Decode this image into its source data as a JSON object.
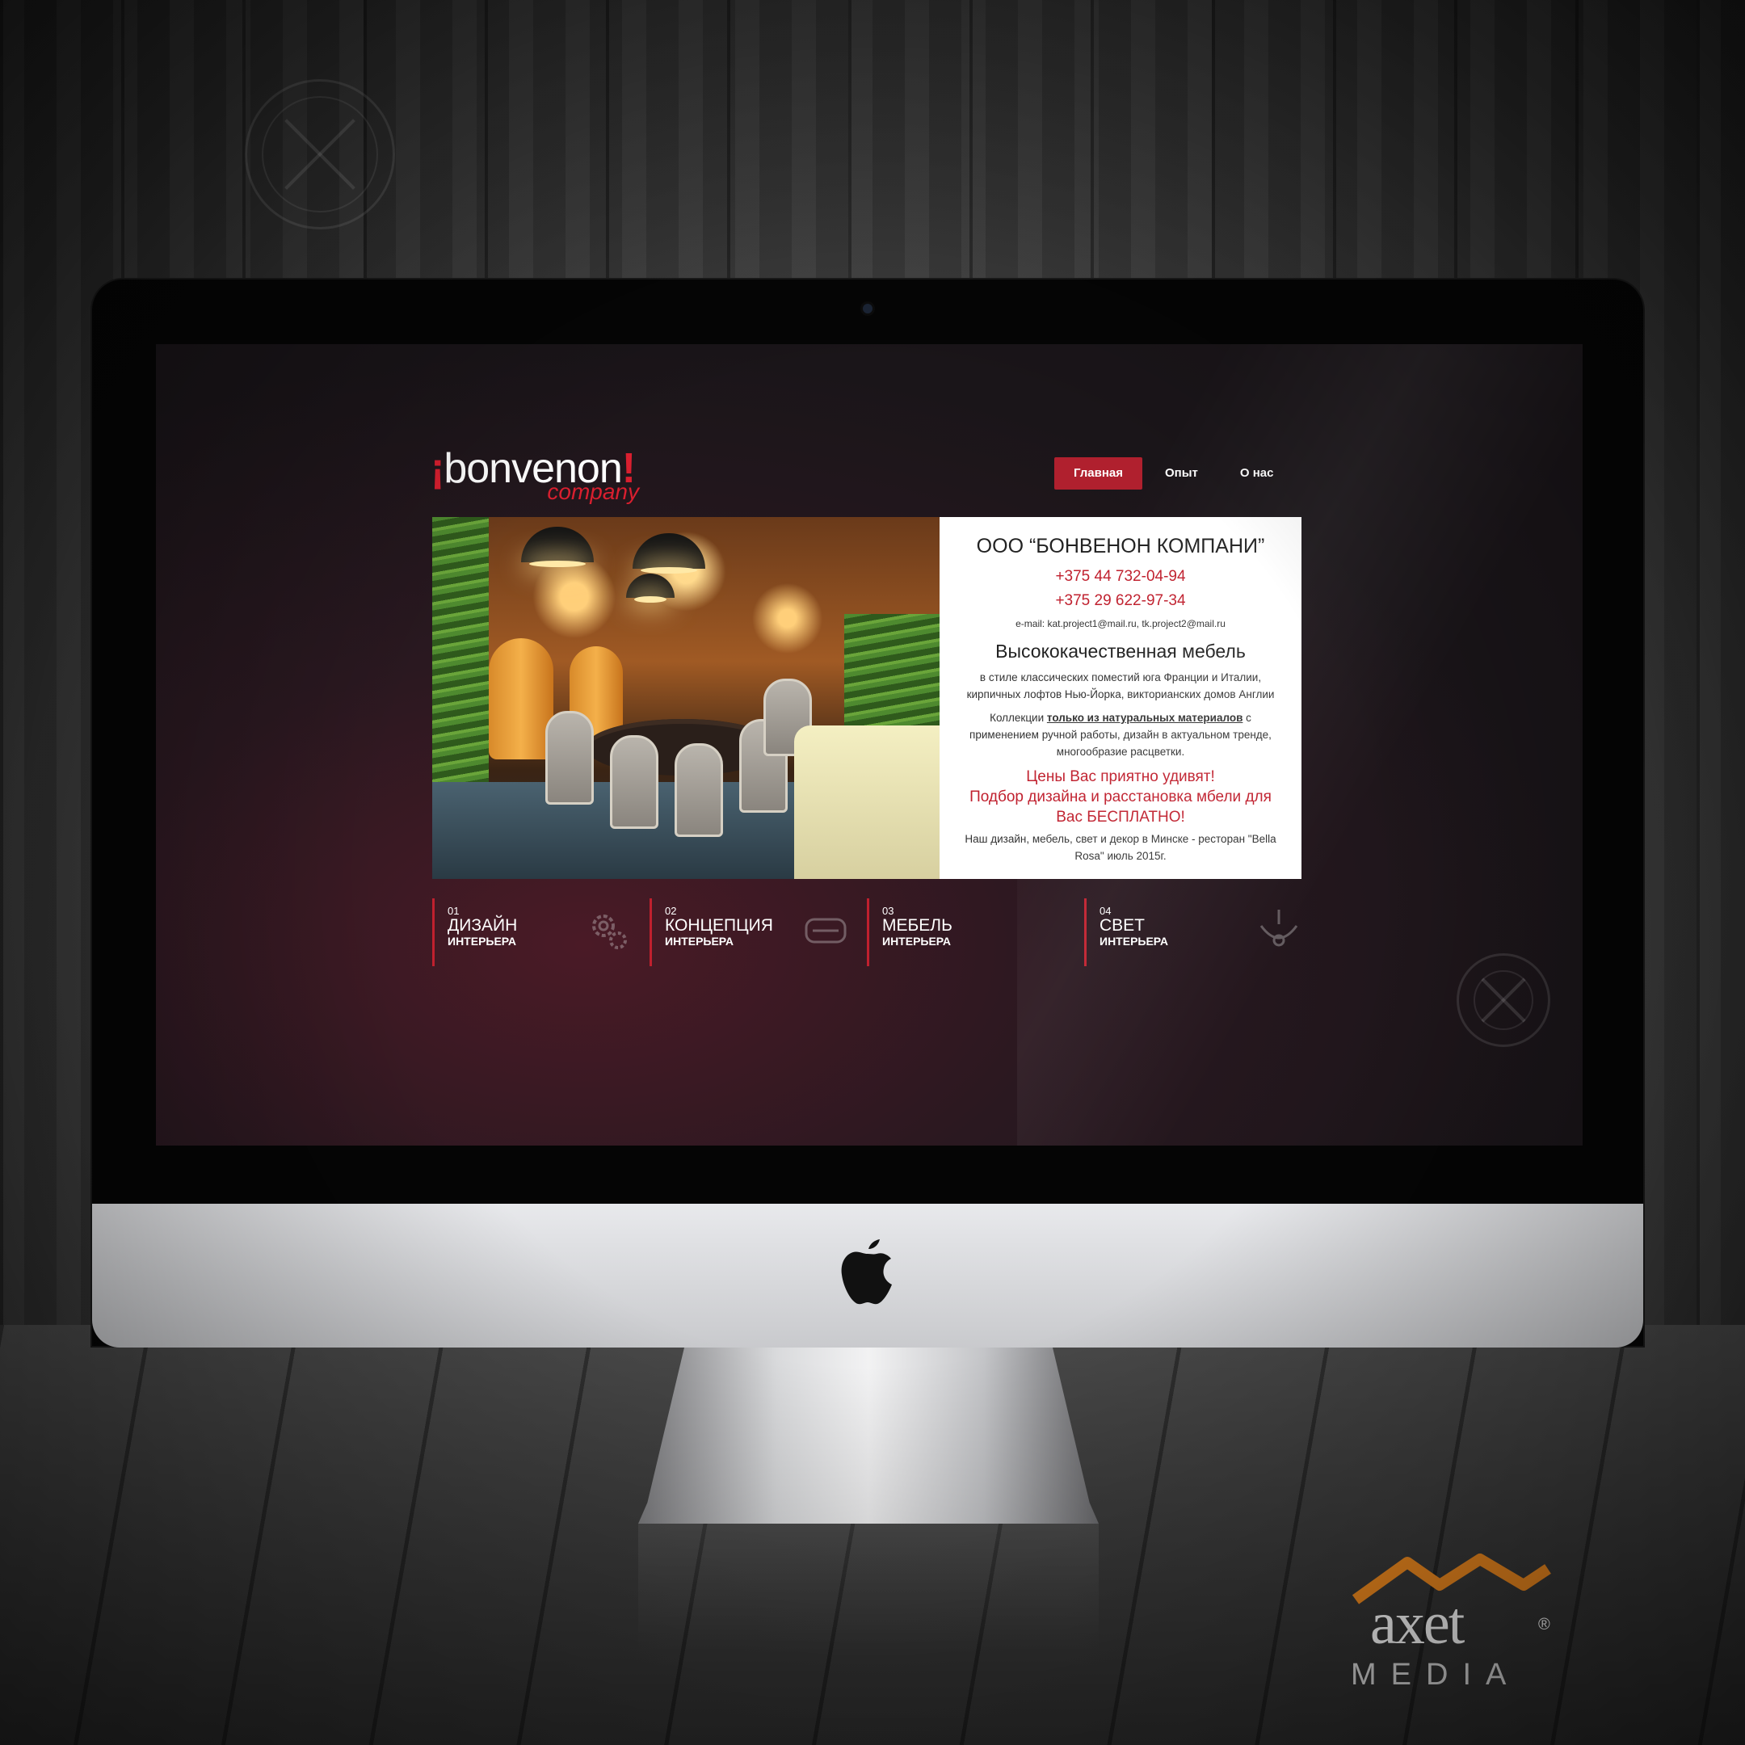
{
  "site": {
    "logo": {
      "main": "bonvenon",
      "sub": "company"
    },
    "nav": [
      {
        "label": "Главная",
        "active": true
      },
      {
        "label": "Опыт",
        "active": false
      },
      {
        "label": "О нас",
        "active": false
      }
    ],
    "hero": {
      "company": "ООО “БОНВЕНОН КОМПАНИ”",
      "phones": [
        "+375 44 732-04-94",
        "+375 29 622-97-34"
      ],
      "email": "e-mail: kat.project1@mail.ru, tk.project2@mail.ru",
      "headline": "Высококачественная мебель",
      "styles": "в стиле классических поместий юга Франции и Италии, кирпичных лофтов Нью-Йорка, викторианских домов Англии",
      "collections_prefix": "Коллекции ",
      "collections_emph": "только из натуральных материалов",
      "collections_suffix": " с применением ручной работы, дизайн в актуальном тренде, многообразие расцветки.",
      "offer_1": "Цены Вас приятно удивят!",
      "offer_2": "Подбор дизайна и расстановка мбели для Вас БЕСПЛАТНО!",
      "project": "Наш дизайн, мебель, свет и декор в Минске - ресторан \"Bella Rosa\" июль 2015г."
    },
    "services": [
      {
        "num": "01",
        "title": "ДИЗАЙН",
        "sub": "ИНТЕРЬЕРА",
        "icon": "brush-icon"
      },
      {
        "num": "02",
        "title": "КОНЦЕПЦИЯ",
        "sub": "ИНТЕРЬЕРА",
        "icon": "gears-icon"
      },
      {
        "num": "03",
        "title": "МЕБЕЛЬ",
        "sub": "ИНТЕРЬЕРА",
        "icon": "sofa-icon"
      },
      {
        "num": "04",
        "title": "СВЕТ",
        "sub": "ИНТЕРЬЕРА",
        "icon": "chandelier-icon"
      }
    ]
  },
  "brand": {
    "word": "axet",
    "media": "MEDIA",
    "reg": "®"
  },
  "colors": {
    "accent": "#c0202e",
    "brand_orange": "#f08a1f"
  }
}
